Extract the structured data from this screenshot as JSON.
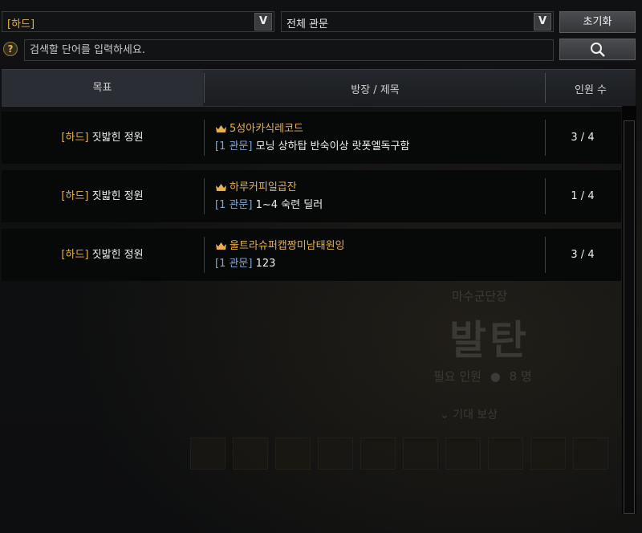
{
  "filters": {
    "difficulty_value": "[하드]",
    "stage_value": "전체 관문",
    "dropdown_arrow": "V",
    "reset_label": "초기화"
  },
  "search": {
    "help_symbol": "?",
    "placeholder": "검색할 단어를 입력하세요.",
    "icon": "search-icon"
  },
  "table": {
    "headers": {
      "goal": "목표",
      "title": "방장 / 제목",
      "count": "인원 수"
    },
    "rows": [
      {
        "tag": "[하드]",
        "goal": "짓밟힌 정원",
        "leader": "5성아카식레코드",
        "stage_tag": "[1 관문]",
        "title": "모닝 상하탑 반숙이상 랏폿엘독구함",
        "count": "3 / 4"
      },
      {
        "tag": "[하드]",
        "goal": "짓밟힌 정원",
        "leader": "하루커피일곱잔",
        "stage_tag": "[1 관문]",
        "title": "1~4 숙련 딜러",
        "count": "1 / 4"
      },
      {
        "tag": "[하드]",
        "goal": "짓밟힌 정원",
        "leader": "울트라슈퍼캡짱미남태원잉",
        "stage_tag": "[1 관문]",
        "title": "123",
        "count": "3 / 4"
      }
    ]
  },
  "background_panel": {
    "subtitle": "마수군단장",
    "title": "발탄",
    "required_label": "필요 인원",
    "required_count": "8 명",
    "reward_label": "기대 보상"
  },
  "colors": {
    "accent": "#e7b04a",
    "stage_tag": "#7fa8d6",
    "background": "#0b0c0d"
  }
}
